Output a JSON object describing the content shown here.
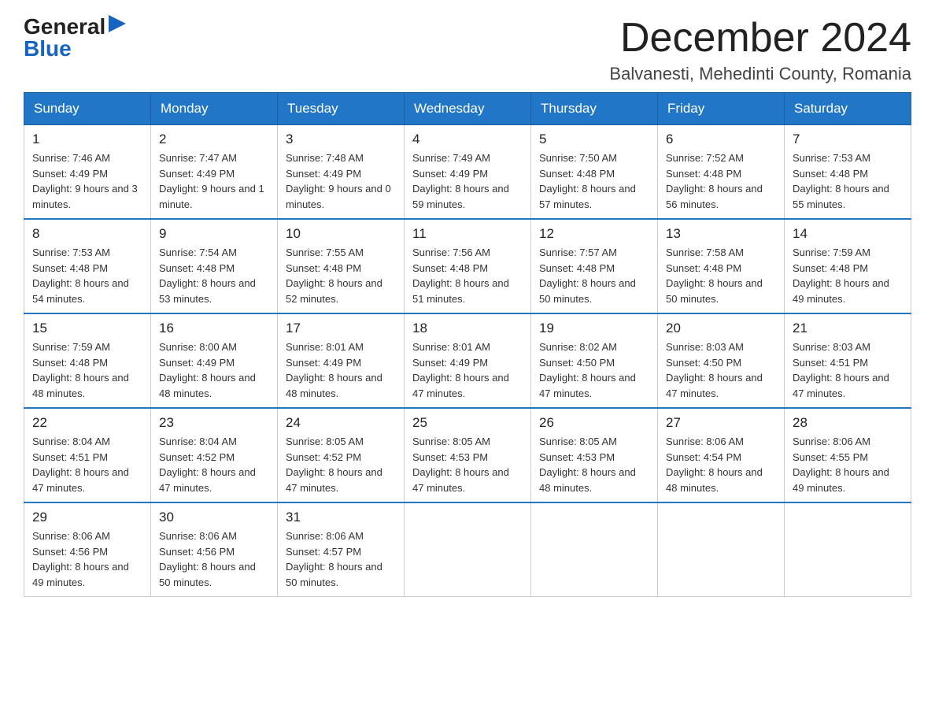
{
  "logo": {
    "general": "General",
    "blue": "Blue"
  },
  "title": "December 2024",
  "location": "Balvanesti, Mehedinti County, Romania",
  "days_of_week": [
    "Sunday",
    "Monday",
    "Tuesday",
    "Wednesday",
    "Thursday",
    "Friday",
    "Saturday"
  ],
  "weeks": [
    [
      {
        "day": "1",
        "sunrise": "7:46 AM",
        "sunset": "4:49 PM",
        "daylight": "9 hours and 3 minutes."
      },
      {
        "day": "2",
        "sunrise": "7:47 AM",
        "sunset": "4:49 PM",
        "daylight": "9 hours and 1 minute."
      },
      {
        "day": "3",
        "sunrise": "7:48 AM",
        "sunset": "4:49 PM",
        "daylight": "9 hours and 0 minutes."
      },
      {
        "day": "4",
        "sunrise": "7:49 AM",
        "sunset": "4:49 PM",
        "daylight": "8 hours and 59 minutes."
      },
      {
        "day": "5",
        "sunrise": "7:50 AM",
        "sunset": "4:48 PM",
        "daylight": "8 hours and 57 minutes."
      },
      {
        "day": "6",
        "sunrise": "7:52 AM",
        "sunset": "4:48 PM",
        "daylight": "8 hours and 56 minutes."
      },
      {
        "day": "7",
        "sunrise": "7:53 AM",
        "sunset": "4:48 PM",
        "daylight": "8 hours and 55 minutes."
      }
    ],
    [
      {
        "day": "8",
        "sunrise": "7:53 AM",
        "sunset": "4:48 PM",
        "daylight": "8 hours and 54 minutes."
      },
      {
        "day": "9",
        "sunrise": "7:54 AM",
        "sunset": "4:48 PM",
        "daylight": "8 hours and 53 minutes."
      },
      {
        "day": "10",
        "sunrise": "7:55 AM",
        "sunset": "4:48 PM",
        "daylight": "8 hours and 52 minutes."
      },
      {
        "day": "11",
        "sunrise": "7:56 AM",
        "sunset": "4:48 PM",
        "daylight": "8 hours and 51 minutes."
      },
      {
        "day": "12",
        "sunrise": "7:57 AM",
        "sunset": "4:48 PM",
        "daylight": "8 hours and 50 minutes."
      },
      {
        "day": "13",
        "sunrise": "7:58 AM",
        "sunset": "4:48 PM",
        "daylight": "8 hours and 50 minutes."
      },
      {
        "day": "14",
        "sunrise": "7:59 AM",
        "sunset": "4:48 PM",
        "daylight": "8 hours and 49 minutes."
      }
    ],
    [
      {
        "day": "15",
        "sunrise": "7:59 AM",
        "sunset": "4:48 PM",
        "daylight": "8 hours and 48 minutes."
      },
      {
        "day": "16",
        "sunrise": "8:00 AM",
        "sunset": "4:49 PM",
        "daylight": "8 hours and 48 minutes."
      },
      {
        "day": "17",
        "sunrise": "8:01 AM",
        "sunset": "4:49 PM",
        "daylight": "8 hours and 48 minutes."
      },
      {
        "day": "18",
        "sunrise": "8:01 AM",
        "sunset": "4:49 PM",
        "daylight": "8 hours and 47 minutes."
      },
      {
        "day": "19",
        "sunrise": "8:02 AM",
        "sunset": "4:50 PM",
        "daylight": "8 hours and 47 minutes."
      },
      {
        "day": "20",
        "sunrise": "8:03 AM",
        "sunset": "4:50 PM",
        "daylight": "8 hours and 47 minutes."
      },
      {
        "day": "21",
        "sunrise": "8:03 AM",
        "sunset": "4:51 PM",
        "daylight": "8 hours and 47 minutes."
      }
    ],
    [
      {
        "day": "22",
        "sunrise": "8:04 AM",
        "sunset": "4:51 PM",
        "daylight": "8 hours and 47 minutes."
      },
      {
        "day": "23",
        "sunrise": "8:04 AM",
        "sunset": "4:52 PM",
        "daylight": "8 hours and 47 minutes."
      },
      {
        "day": "24",
        "sunrise": "8:05 AM",
        "sunset": "4:52 PM",
        "daylight": "8 hours and 47 minutes."
      },
      {
        "day": "25",
        "sunrise": "8:05 AM",
        "sunset": "4:53 PM",
        "daylight": "8 hours and 47 minutes."
      },
      {
        "day": "26",
        "sunrise": "8:05 AM",
        "sunset": "4:53 PM",
        "daylight": "8 hours and 48 minutes."
      },
      {
        "day": "27",
        "sunrise": "8:06 AM",
        "sunset": "4:54 PM",
        "daylight": "8 hours and 48 minutes."
      },
      {
        "day": "28",
        "sunrise": "8:06 AM",
        "sunset": "4:55 PM",
        "daylight": "8 hours and 49 minutes."
      }
    ],
    [
      {
        "day": "29",
        "sunrise": "8:06 AM",
        "sunset": "4:56 PM",
        "daylight": "8 hours and 49 minutes."
      },
      {
        "day": "30",
        "sunrise": "8:06 AM",
        "sunset": "4:56 PM",
        "daylight": "8 hours and 50 minutes."
      },
      {
        "day": "31",
        "sunrise": "8:06 AM",
        "sunset": "4:57 PM",
        "daylight": "8 hours and 50 minutes."
      },
      null,
      null,
      null,
      null
    ]
  ]
}
